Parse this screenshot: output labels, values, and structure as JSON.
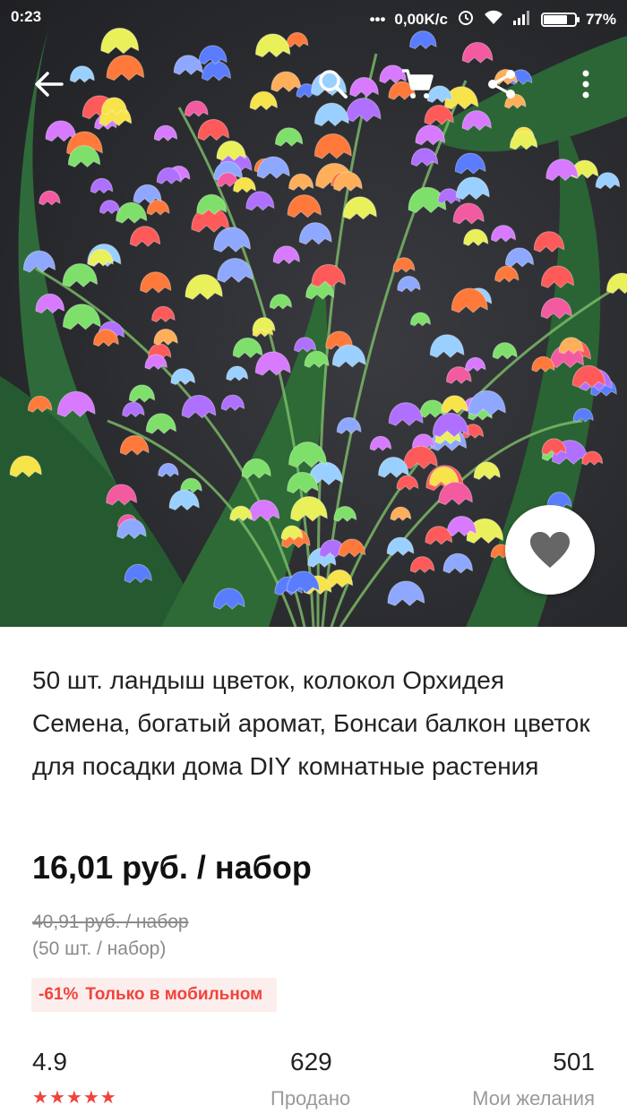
{
  "status_bar": {
    "time": "0:23",
    "dots": "•••",
    "network_speed": "0,00K/c",
    "battery_percent": "77%",
    "battery_level": 0.77
  },
  "top_bar": {
    "icons": [
      "back-arrow-icon",
      "search-icon",
      "cart-icon",
      "share-icon",
      "more-icon"
    ]
  },
  "wishlist_button": {
    "icon": "heart-icon"
  },
  "product": {
    "title": "50 шт. ландыш цветок, колокол Орхидея Семена, богатый аромат, Бонсаи балкон цветок для посадки дома DIY комнатные растения",
    "price": "16,01 руб. / набор",
    "old_price": "40,91 руб. / набор",
    "unit_note": "(50 шт. / набор)",
    "promo": {
      "discount": "-61%",
      "text": "Только в мобильном",
      "color": "#f0443a"
    }
  },
  "stats": {
    "rating": "4.9",
    "stars": 5,
    "sold_count": "629",
    "sold_label": "Продано",
    "wish_count": "501",
    "wish_label": "Мои желания"
  }
}
